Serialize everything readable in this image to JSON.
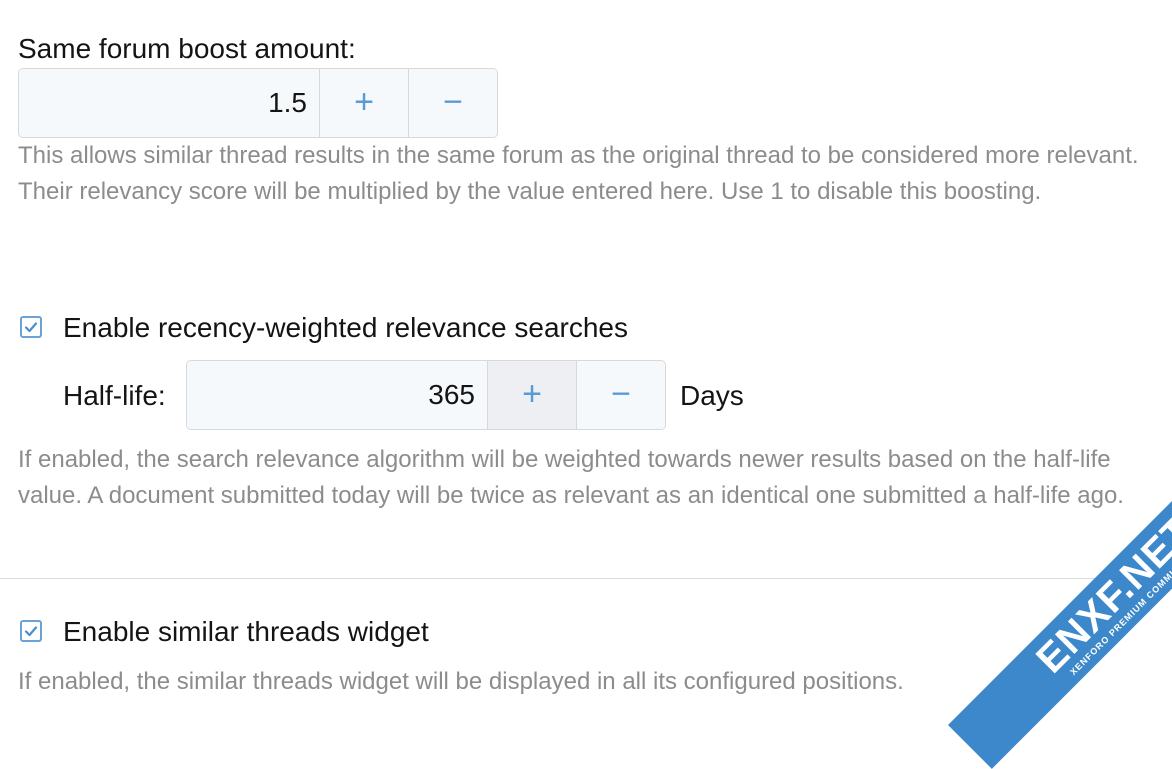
{
  "boost": {
    "label": "Same forum boost amount:",
    "value": "1.5",
    "increment": "+",
    "decrement": "−",
    "explain": "This allows similar thread results in the same forum as the original thread to be considered more relevant. Their relevancy score will be multiplied by the value entered here. Use 1 to disable this boosting."
  },
  "recency": {
    "checked": true,
    "label": "Enable recency-weighted relevance searches",
    "halflife_label": "Half-life:",
    "halflife_value": "365",
    "increment": "+",
    "decrement": "−",
    "unit": "Days",
    "explain": "If enabled, the search relevance algorithm will be weighted towards newer results based on the half-life value. A document submitted today will be twice as relevant as an identical one submitted a half-life ago."
  },
  "widget": {
    "checked": true,
    "label": "Enable similar threads widget",
    "explain": "If enabled, the similar threads widget will be displayed in all its configured positions."
  },
  "watermark": {
    "main": "ENXF.NET",
    "sub": "XENFORO PREMIUM COMMUNITY"
  },
  "colors": {
    "accent": "#5b9bd5",
    "checkbox_border": "#6aa3d8",
    "explain_text": "#8c8c8c",
    "input_bg": "#f6f9fc",
    "watermark": "#2c7ec7"
  },
  "icons": {
    "checkbox": "checkmark-icon",
    "increment": "plus-icon",
    "decrement": "minus-icon"
  }
}
